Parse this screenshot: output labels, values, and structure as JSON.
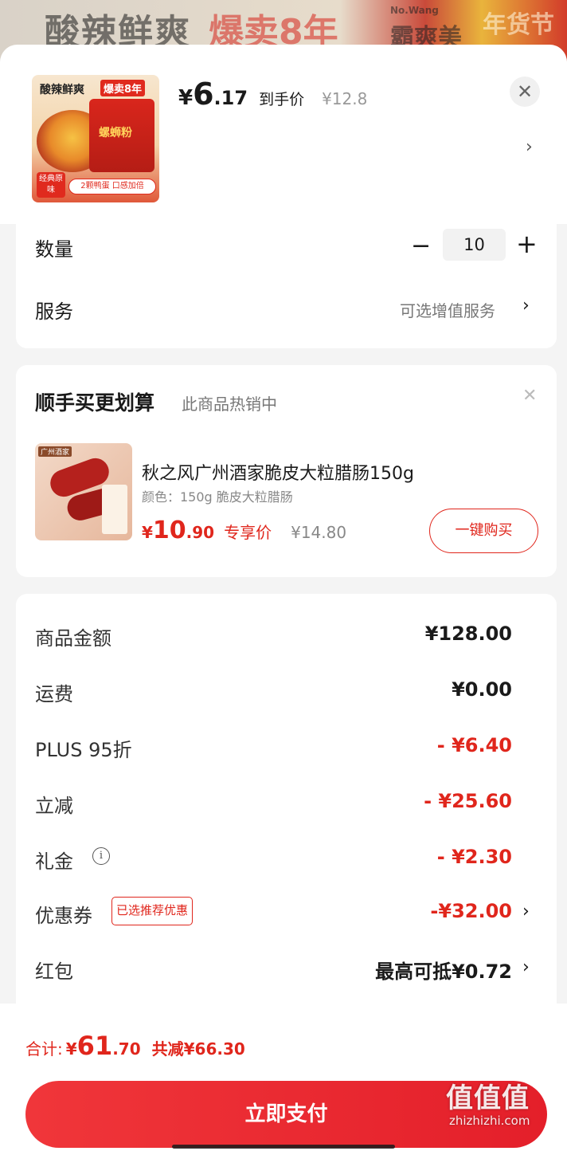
{
  "background_banner": {
    "text_left": "酸辣鲜爽",
    "text_mid": "爆卖8年",
    "text_small": "No.Wang",
    "text_right": "霸爽美",
    "text_far": "年货节"
  },
  "product": {
    "image_headline": "酸辣鲜爽",
    "image_badge": "爆卖8年",
    "image_pack_label": "螺蛳粉",
    "image_tag_left": "经典原味",
    "image_tag_right": "2颗鸭蛋 口感加倍",
    "price_currency": "¥",
    "price_int": "6",
    "price_dec": ".17",
    "price_label": "到手价",
    "original_price": "¥12.8"
  },
  "icons": {
    "close": "✕",
    "chevron": "›",
    "minus": "−",
    "plus": "+",
    "info": "i"
  },
  "quantity": {
    "label": "数量",
    "value": "10"
  },
  "service": {
    "label": "服务",
    "value": "可选增值服务"
  },
  "upsell": {
    "title": "顺手买更划算",
    "subtitle": "此商品热销中",
    "image_tag": "广州酒家",
    "name": "秋之风广州酒家脆皮大粒腊肠150g",
    "spec": "颜色：150g 脆皮大粒腊肠",
    "price_currency": "¥",
    "price_int": "10",
    "price_dec": ".90",
    "price_tag": "专享价",
    "original_price": "¥14.80",
    "buy_label": "一键购买"
  },
  "fees": [
    {
      "label": "商品金额",
      "value": "¥128.00"
    },
    {
      "label": "运费",
      "value": "¥0.00"
    },
    {
      "label": "PLUS 95折",
      "value": "- ¥6.40"
    },
    {
      "label": "立减",
      "value": "- ¥25.60"
    },
    {
      "label": "礼金",
      "value": "- ¥2.30"
    },
    {
      "label": "优惠券",
      "tag": "已选推荐优惠",
      "value": "-¥32.00"
    },
    {
      "label": "红包",
      "value": "最高可抵¥0.72"
    }
  ],
  "summary": {
    "total_label": "合计:",
    "total_currency": "¥",
    "total_int": "61",
    "total_dec": ".70",
    "saved_text": "共减¥66.30",
    "pay_label": "立即支付"
  },
  "watermark": {
    "logo": "值值值",
    "site": "zhizhizhi.com"
  },
  "colors": {
    "accent_red": "#e0261c",
    "pay_button": "#e41f2a"
  }
}
